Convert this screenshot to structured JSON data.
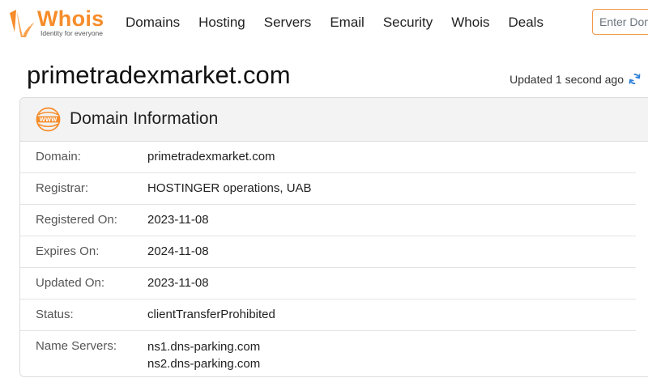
{
  "brand": {
    "name": "Whois",
    "tagline": "Identity for everyone",
    "accent_color": "#f68c2a"
  },
  "nav": {
    "items": [
      "Domains",
      "Hosting",
      "Servers",
      "Email",
      "Security",
      "Whois",
      "Deals"
    ]
  },
  "search": {
    "placeholder": "Enter Domain"
  },
  "page": {
    "title": "primetradexmarket.com",
    "updated_text": "Updated 1 second ago",
    "refresh_icon": "refresh-icon"
  },
  "card": {
    "icon": "www-icon",
    "title": "Domain Information",
    "rows": [
      {
        "label": "Domain:",
        "value": "primetradexmarket.com"
      },
      {
        "label": "Registrar:",
        "value": "HOSTINGER operations, UAB"
      },
      {
        "label": "Registered On:",
        "value": "2023-11-08"
      },
      {
        "label": "Expires On:",
        "value": "2024-11-08"
      },
      {
        "label": "Updated On:",
        "value": "2023-11-08"
      },
      {
        "label": "Status:",
        "value": "clientTransferProhibited"
      },
      {
        "label": "Name Servers:",
        "values": [
          "ns1.dns-parking.com",
          "ns2.dns-parking.com"
        ]
      }
    ]
  }
}
